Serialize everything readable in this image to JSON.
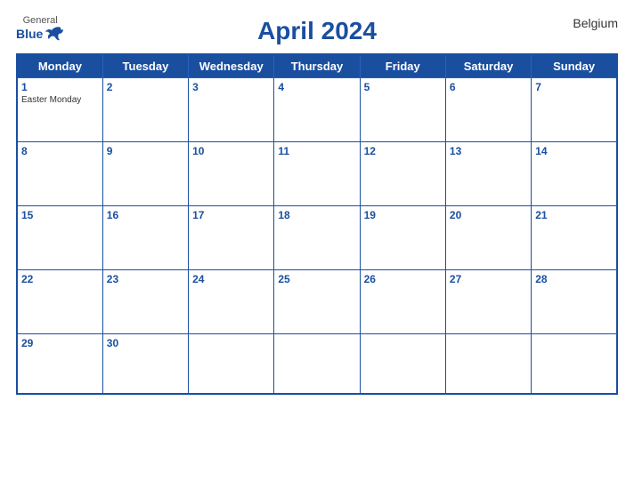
{
  "logo": {
    "general": "General",
    "blue": "Blue",
    "bird_symbol": "🐦"
  },
  "title": "April 2024",
  "country": "Belgium",
  "days_of_week": [
    "Monday",
    "Tuesday",
    "Wednesday",
    "Thursday",
    "Friday",
    "Saturday",
    "Sunday"
  ],
  "weeks": [
    [
      {
        "day": "1",
        "holiday": "Easter Monday"
      },
      {
        "day": "2",
        "holiday": ""
      },
      {
        "day": "3",
        "holiday": ""
      },
      {
        "day": "4",
        "holiday": ""
      },
      {
        "day": "5",
        "holiday": ""
      },
      {
        "day": "6",
        "holiday": ""
      },
      {
        "day": "7",
        "holiday": ""
      }
    ],
    [
      {
        "day": "8",
        "holiday": ""
      },
      {
        "day": "9",
        "holiday": ""
      },
      {
        "day": "10",
        "holiday": ""
      },
      {
        "day": "11",
        "holiday": ""
      },
      {
        "day": "12",
        "holiday": ""
      },
      {
        "day": "13",
        "holiday": ""
      },
      {
        "day": "14",
        "holiday": ""
      }
    ],
    [
      {
        "day": "15",
        "holiday": ""
      },
      {
        "day": "16",
        "holiday": ""
      },
      {
        "day": "17",
        "holiday": ""
      },
      {
        "day": "18",
        "holiday": ""
      },
      {
        "day": "19",
        "holiday": ""
      },
      {
        "day": "20",
        "holiday": ""
      },
      {
        "day": "21",
        "holiday": ""
      }
    ],
    [
      {
        "day": "22",
        "holiday": ""
      },
      {
        "day": "23",
        "holiday": ""
      },
      {
        "day": "24",
        "holiday": ""
      },
      {
        "day": "25",
        "holiday": ""
      },
      {
        "day": "26",
        "holiday": ""
      },
      {
        "day": "27",
        "holiday": ""
      },
      {
        "day": "28",
        "holiday": ""
      }
    ],
    [
      {
        "day": "29",
        "holiday": ""
      },
      {
        "day": "30",
        "holiday": ""
      },
      {
        "day": "",
        "holiday": ""
      },
      {
        "day": "",
        "holiday": ""
      },
      {
        "day": "",
        "holiday": ""
      },
      {
        "day": "",
        "holiday": ""
      },
      {
        "day": "",
        "holiday": ""
      }
    ]
  ]
}
